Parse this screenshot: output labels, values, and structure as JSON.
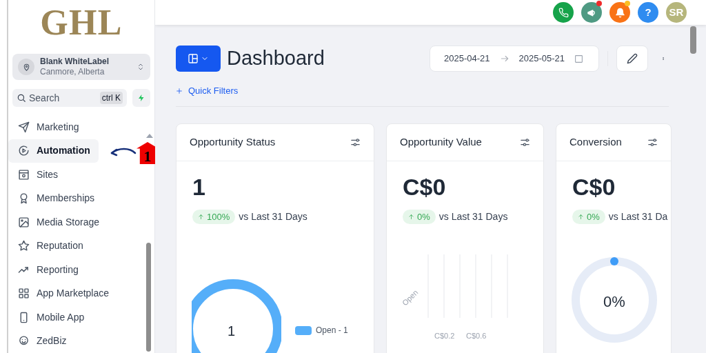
{
  "logo": {
    "text": "GHL"
  },
  "account": {
    "name": "Blank WhiteLabel",
    "location": "Canmore, Alberta"
  },
  "search": {
    "placeholder": "Search",
    "shortcut": "ctrl K"
  },
  "sidebar": {
    "items": [
      {
        "label": "Marketing",
        "kind": "send",
        "selected": false
      },
      {
        "label": "Automation",
        "kind": "automation",
        "selected": true
      },
      {
        "label": "Sites",
        "kind": "sites",
        "selected": false
      },
      {
        "label": "Memberships",
        "kind": "award",
        "selected": false
      },
      {
        "label": "Media Storage",
        "kind": "image",
        "selected": false
      },
      {
        "label": "Reputation",
        "kind": "star",
        "selected": false
      },
      {
        "label": "Reporting",
        "kind": "trend",
        "selected": false
      },
      {
        "label": "App Marketplace",
        "kind": "grid",
        "selected": false
      },
      {
        "label": "Mobile App",
        "kind": "mobile",
        "selected": false
      },
      {
        "label": "ZedBiz",
        "kind": "smiley",
        "selected": false
      }
    ]
  },
  "annotation": {
    "label": "1"
  },
  "header_actions": [
    {
      "kind": "phone",
      "color": "#16a34a",
      "dot": false
    },
    {
      "kind": "megaphone",
      "color": "#4f9a83",
      "dot": true
    },
    {
      "kind": "bell",
      "color": "#f97316",
      "dot": true
    },
    {
      "kind": "help",
      "color": "#2f8cf0",
      "text": "?",
      "dot": false
    },
    {
      "kind": "avatar",
      "color": "#b6b67c",
      "text": "SR",
      "dot": false
    }
  ],
  "page": {
    "title": "Dashboard",
    "date_from": "2025-04-21",
    "date_to": "2025-05-21",
    "quick_filters": "Quick Filters"
  },
  "cards": [
    {
      "kind": "donut",
      "title": "Opportunity Status",
      "value": "1",
      "change": "100%",
      "comparison": "vs Last 31 Days",
      "center": "1",
      "legend": "Open - 1"
    },
    {
      "kind": "bar",
      "title": "Opportunity Value",
      "value": "C$0",
      "change": "0%",
      "comparison": "vs Last 31 Days",
      "category_label": "Open",
      "axis_labels": [
        "C$0.2",
        "C$0.6"
      ]
    },
    {
      "kind": "gauge",
      "title": "Conversion",
      "value": "C$0",
      "change": "0%",
      "comparison": "vs Last 31 Da",
      "reading": "0%"
    }
  ]
}
